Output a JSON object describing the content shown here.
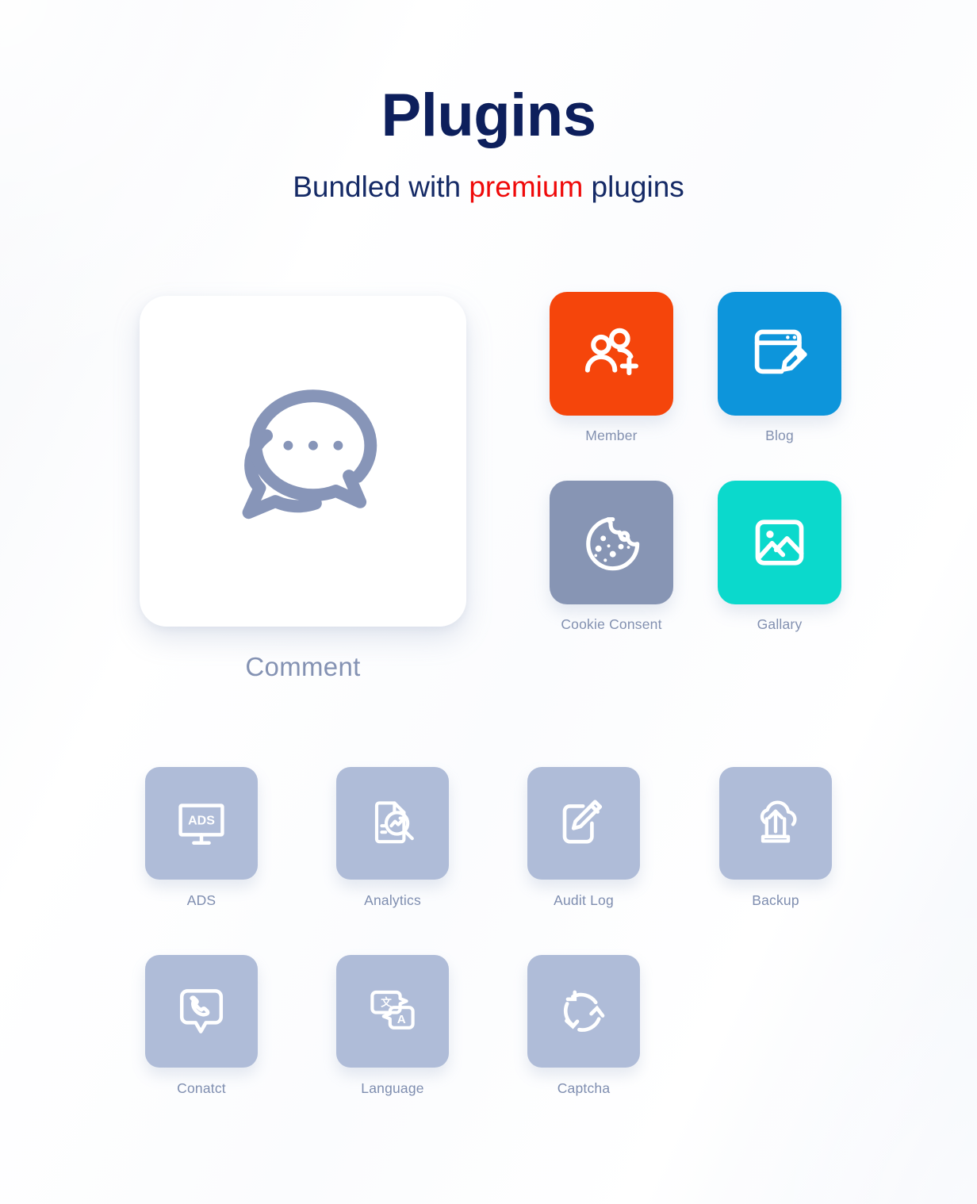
{
  "header": {
    "title": "Plugins",
    "subtitle_before": "Bundled with ",
    "subtitle_highlight": "premium",
    "subtitle_after": " plugins",
    "title_color": "#0d1f5c",
    "highlight_color": "#ef0a0a"
  },
  "hero": {
    "label": "Comment",
    "icon": "comment-bubbles-icon",
    "card_color": "#ffffff",
    "icon_color": "#8795b8"
  },
  "featured_tiles": [
    {
      "label": "Member",
      "icon": "user-add-icon",
      "color": "#f5450b",
      "icon_color": "#ffffff"
    },
    {
      "label": "Blog",
      "icon": "browser-pen-icon",
      "color": "#0d95db",
      "icon_color": "#ffffff"
    },
    {
      "label": "Cookie Consent",
      "icon": "cookie-icon",
      "color": "#8795b4",
      "icon_color": "#ffffff"
    },
    {
      "label": "Gallary",
      "icon": "image-icon",
      "color": "#0bd9cc",
      "icon_color": "#ffffff"
    }
  ],
  "plugin_tiles": [
    {
      "label": "ADS",
      "icon": "monitor-ads-icon",
      "color": "#afbcd8",
      "icon_color": "#ffffff"
    },
    {
      "label": "Analytics",
      "icon": "report-search-icon",
      "color": "#afbcd8",
      "icon_color": "#ffffff"
    },
    {
      "label": "Audit Log",
      "icon": "edit-square-icon",
      "color": "#afbcd8",
      "icon_color": "#ffffff"
    },
    {
      "label": "Backup",
      "icon": "cloud-upload-icon",
      "color": "#afbcd8",
      "icon_color": "#ffffff"
    },
    {
      "label": "Conatct",
      "icon": "phone-bubble-icon",
      "color": "#afbcd8",
      "icon_color": "#ffffff"
    },
    {
      "label": "Language",
      "icon": "translate-icon",
      "color": "#afbcd8",
      "icon_color": "#ffffff"
    },
    {
      "label": "Captcha",
      "icon": "refresh-circle-icon",
      "color": "#afbcd8",
      "icon_color": "#ffffff"
    }
  ],
  "icon_glyph_labels": {
    "ads": "ADS",
    "translate_source": "文",
    "translate_target": "A"
  },
  "background": {
    "base_color": "#ffffff",
    "band_color": "#dbe3f1",
    "accent_band_color": "#cddff5"
  }
}
